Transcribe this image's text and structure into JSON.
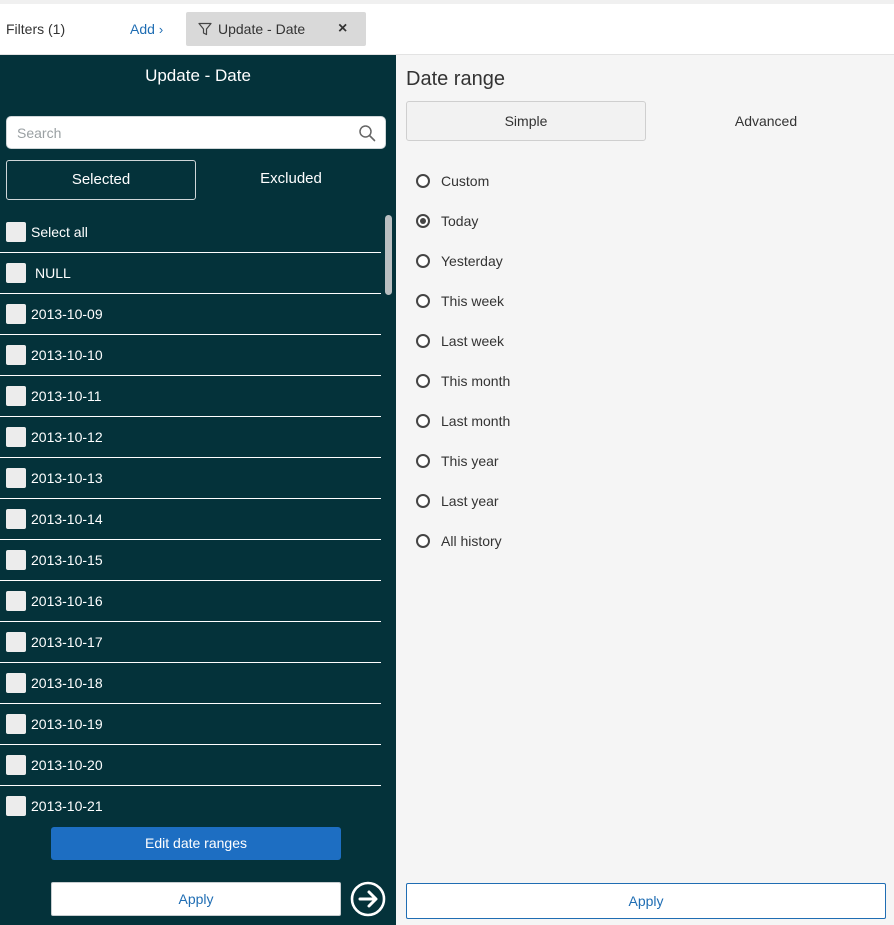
{
  "topbar": {
    "filters_label": "Filters (1)",
    "add_label": "Add",
    "chip_label": "Update - Date",
    "chip_close": "×"
  },
  "left_panel": {
    "title": "Update - Date",
    "search_placeholder": "Search",
    "search_value": "",
    "tabs": {
      "selected": "Selected",
      "excluded": "Excluded"
    },
    "items": [
      {
        "label": "Select all",
        "checked": false
      },
      {
        "label": "NULL",
        "checked": false
      },
      {
        "label": "2013-10-09",
        "checked": false
      },
      {
        "label": "2013-10-10",
        "checked": false
      },
      {
        "label": "2013-10-11",
        "checked": false
      },
      {
        "label": "2013-10-12",
        "checked": false
      },
      {
        "label": "2013-10-13",
        "checked": false
      },
      {
        "label": "2013-10-14",
        "checked": false
      },
      {
        "label": "2013-10-15",
        "checked": false
      },
      {
        "label": "2013-10-16",
        "checked": false
      },
      {
        "label": "2013-10-17",
        "checked": false
      },
      {
        "label": "2013-10-18",
        "checked": false
      },
      {
        "label": "2013-10-19",
        "checked": false
      },
      {
        "label": "2013-10-20",
        "checked": false
      },
      {
        "label": "2013-10-21",
        "checked": false
      }
    ],
    "edit_button": "Edit date ranges",
    "apply_button": "Apply"
  },
  "right_panel": {
    "title": "Date range",
    "tabs": {
      "simple": "Simple",
      "advanced": "Advanced"
    },
    "active_tab": "Simple",
    "options": [
      {
        "label": "Custom",
        "selected": false
      },
      {
        "label": "Today",
        "selected": true
      },
      {
        "label": "Yesterday",
        "selected": false
      },
      {
        "label": "This week",
        "selected": false
      },
      {
        "label": "Last week",
        "selected": false
      },
      {
        "label": "This month",
        "selected": false
      },
      {
        "label": "Last month",
        "selected": false
      },
      {
        "label": "This year",
        "selected": false
      },
      {
        "label": "Last year",
        "selected": false
      },
      {
        "label": "All history",
        "selected": false
      }
    ],
    "apply_button": "Apply"
  },
  "colors": {
    "panel_bg": "#04323a",
    "accent_blue": "#1d6ec2",
    "link_blue": "#1f6db3",
    "right_bg": "#f5f5f5"
  },
  "icons": {
    "chip": "filter-funnel-icon",
    "search": "search-icon",
    "go": "arrow-right-circle-icon",
    "add_chevron": "chevron-right-icon"
  }
}
